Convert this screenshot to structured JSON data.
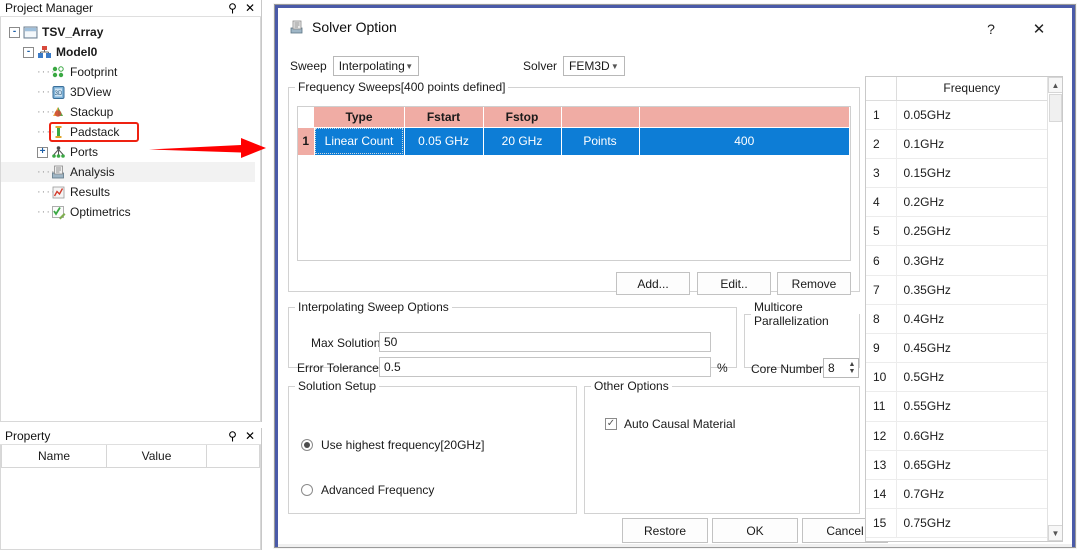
{
  "project_panel": {
    "title": "Project Manager",
    "pin_icon": "pin-icon",
    "close_icon": "close-icon",
    "tree": [
      {
        "label": "TSV_Array",
        "depth": 0,
        "bold": true,
        "expander": "-",
        "icon": "project-icon",
        "selected": false
      },
      {
        "label": "Model0",
        "depth": 1,
        "bold": true,
        "expander": "-",
        "icon": "model-icon",
        "selected": false
      },
      {
        "label": "Footprint",
        "depth": 2,
        "bold": false,
        "expander": "",
        "icon": "footprint-icon",
        "selected": false
      },
      {
        "label": "3DView",
        "depth": 2,
        "bold": false,
        "expander": "",
        "icon": "3dview-icon",
        "selected": false
      },
      {
        "label": "Stackup",
        "depth": 2,
        "bold": false,
        "expander": "",
        "icon": "stackup-icon",
        "selected": false
      },
      {
        "label": "Padstack",
        "depth": 2,
        "bold": false,
        "expander": "",
        "icon": "padstack-icon",
        "selected": false
      },
      {
        "label": "Ports",
        "depth": 2,
        "bold": false,
        "expander": "+",
        "icon": "ports-icon",
        "selected": false
      },
      {
        "label": "Analysis",
        "depth": 2,
        "bold": false,
        "expander": "",
        "icon": "analysis-icon",
        "selected": true
      },
      {
        "label": "Results",
        "depth": 2,
        "bold": false,
        "expander": "",
        "icon": "results-icon",
        "selected": false
      },
      {
        "label": "Optimetrics",
        "depth": 2,
        "bold": false,
        "expander": "",
        "icon": "optimetrics-icon",
        "selected": false
      }
    ],
    "highlight_color": "#ee2211",
    "arrow_color": "#ff0000"
  },
  "property_panel": {
    "title": "Property",
    "pin_icon": "pin-icon",
    "close_icon": "close-icon",
    "columns": [
      "Name",
      "Value",
      ""
    ]
  },
  "dialog": {
    "title": "Solver Option",
    "title_icon": "solver-icon",
    "help_label": "?",
    "close_label": "✕",
    "accent_color": "#4a5aa8",
    "sweep": {
      "label": "Sweep",
      "value": "Interpolating"
    },
    "solver": {
      "label": "Solver",
      "value": "FEM3D"
    },
    "frequency_sweeps": {
      "legend": "Frequency Sweeps[400 points defined]",
      "columns": [
        "",
        "Type",
        "Fstart",
        "Fstop",
        "",
        ""
      ],
      "header_color": "#f0aca4",
      "selected_color": "#0d7dd6",
      "rows": [
        {
          "index": "1",
          "type": "Linear Count",
          "fstart": "0.05 GHz",
          "fstop": "20 GHz",
          "count_label": "Points",
          "count_value": "400"
        }
      ],
      "buttons": {
        "add": "Add...",
        "edit": "Edit..",
        "remove": "Remove"
      }
    },
    "interpolating_sweep_options": {
      "legend": "Interpolating Sweep Options",
      "max_solutions": {
        "label": "Max Solutions:",
        "value": "50"
      },
      "error_tolerance": {
        "label": "Error Tolerance:",
        "value": "0.5",
        "unit": "%"
      }
    },
    "multicore": {
      "legend": "Multicore Parallelization",
      "core_number": {
        "label": "Core Number:",
        "value": "8"
      }
    },
    "solution_setup": {
      "legend": "Solution Setup",
      "options": [
        {
          "label": "Use highest frequency[20GHz]",
          "selected": true
        },
        {
          "label": "Advanced Frequency",
          "selected": false
        }
      ]
    },
    "other_options": {
      "legend": "Other Options",
      "checkboxes": [
        {
          "label": "Auto Causal Material",
          "checked": true
        }
      ]
    },
    "footer_buttons": {
      "restore": "Restore",
      "ok": "OK",
      "cancel": "Cancel"
    },
    "frequency_list": {
      "column_header": "Frequency",
      "scroll_up_icon": "scroll-up-icon",
      "scroll_down_icon": "scroll-down-icon",
      "rows": [
        {
          "n": "1",
          "f": "0.05GHz"
        },
        {
          "n": "2",
          "f": "0.1GHz"
        },
        {
          "n": "3",
          "f": "0.15GHz"
        },
        {
          "n": "4",
          "f": "0.2GHz"
        },
        {
          "n": "5",
          "f": "0.25GHz"
        },
        {
          "n": "6",
          "f": "0.3GHz"
        },
        {
          "n": "7",
          "f": "0.35GHz"
        },
        {
          "n": "8",
          "f": "0.4GHz"
        },
        {
          "n": "9",
          "f": "0.45GHz"
        },
        {
          "n": "10",
          "f": "0.5GHz"
        },
        {
          "n": "11",
          "f": "0.55GHz"
        },
        {
          "n": "12",
          "f": "0.6GHz"
        },
        {
          "n": "13",
          "f": "0.65GHz"
        },
        {
          "n": "14",
          "f": "0.7GHz"
        },
        {
          "n": "15",
          "f": "0.75GHz"
        }
      ]
    }
  }
}
